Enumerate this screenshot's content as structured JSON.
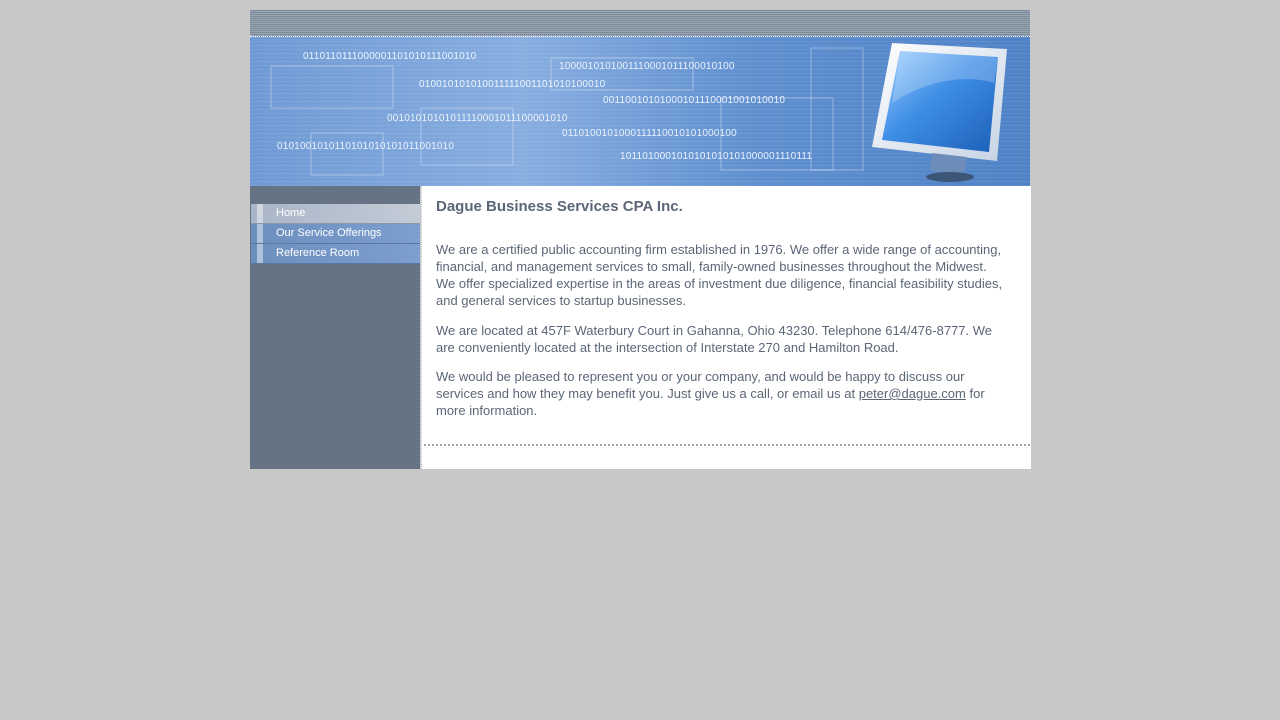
{
  "banner": {
    "binary_lines": [
      "0110110111000001101010111001010",
      "1000010101001110001011100010100",
      "010010101010011111001101010100010",
      "00110010101000101110001001010010",
      "00101010101011110001011100001010",
      "0110100101000111110010101000100",
      "0101001010110101010101011001010",
      "1011010001010101010101000001110111"
    ],
    "monitor_icon": "monitor-icon",
    "colors": {
      "banner_blue": "#6f9ad4",
      "sidebar": "#657385",
      "text": "#5b6677",
      "background": "#c8c8c8"
    }
  },
  "nav": {
    "items": [
      {
        "label": "Home",
        "active": true
      },
      {
        "label": "Our Service Offerings",
        "active": false
      },
      {
        "label": "Reference Room",
        "active": false
      }
    ]
  },
  "content": {
    "title": "Dague Business Services CPA Inc.",
    "p1": "We are a certified public accounting firm established in 1976. We offer a wide range of accounting, financial, and management services to small, family-owned businesses throughout the Midwest. We offer specialized expertise in the areas of investment due diligence, financial feasibility studies, and general services to startup businesses.",
    "p2": "We are located at 457F Waterbury Court in Gahanna, Ohio 43230. Telephone 614/476-8777. We are conveniently located at the intersection of Interstate 270 and Hamilton Road.",
    "p3_before": "We would be pleased to represent you or your company, and would be happy to discuss our services and how they may benefit you. Just give us a call, or email us at",
    "email": "peter@dague.com",
    "p3_after": "for more information."
  }
}
